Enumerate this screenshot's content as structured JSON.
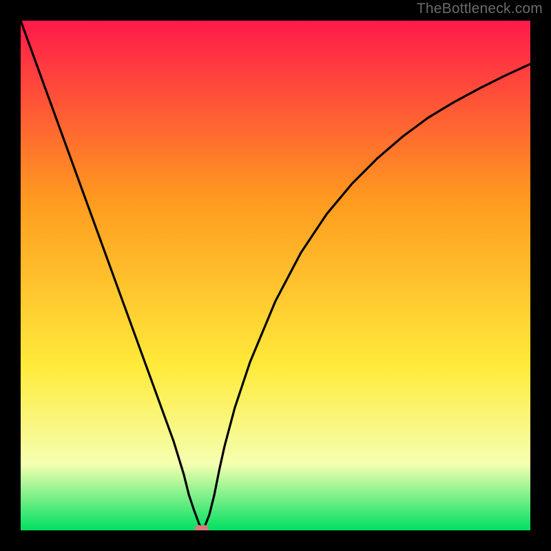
{
  "watermark": "TheBottleneck.com",
  "chart_data": {
    "type": "line",
    "title": "",
    "xlabel": "",
    "ylabel": "",
    "xlim": [
      0,
      100
    ],
    "ylim": [
      0,
      100
    ],
    "background_gradient": {
      "top": "#FF1A4B",
      "mid1": "#FF9A1F",
      "mid2": "#FFEB3B",
      "mid3": "#F5FFB0",
      "bottom": "#00E060"
    },
    "series": [
      {
        "name": "bottleneck-curve",
        "color": "#000000",
        "x": [
          0,
          2,
          4,
          6,
          8,
          10,
          12,
          14,
          16,
          18,
          20,
          22,
          24,
          26,
          28,
          30,
          32,
          33,
          34,
          35,
          35.5,
          36,
          37,
          38,
          39,
          40,
          42,
          45,
          50,
          55,
          60,
          65,
          70,
          75,
          80,
          85,
          90,
          95,
          100
        ],
        "y": [
          100,
          94.5,
          89,
          83.5,
          78,
          72.5,
          67,
          61.5,
          56,
          50.5,
          45,
          39.5,
          34,
          28.5,
          23,
          17.5,
          11,
          7,
          4,
          1.3,
          0.3,
          0.5,
          3,
          7,
          12,
          16.5,
          24,
          33,
          45,
          54.5,
          62,
          68,
          73,
          77.3,
          81,
          84,
          86.7,
          89.2,
          91.5
        ]
      }
    ],
    "marker": {
      "name": "minimum-point",
      "x": 35.5,
      "y": 0.3,
      "color": "#D97A7A"
    }
  }
}
